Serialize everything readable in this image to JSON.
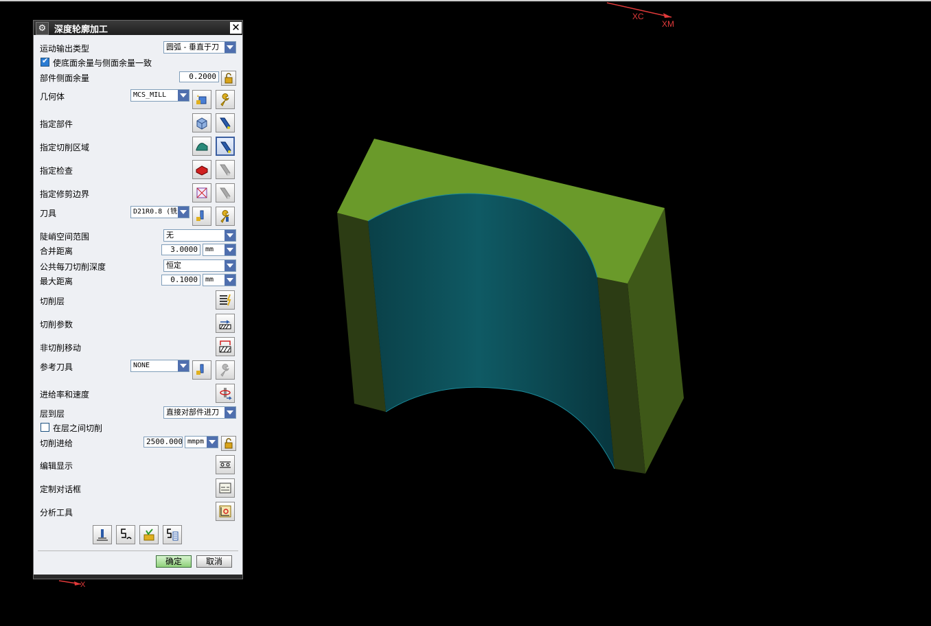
{
  "dialog": {
    "title": "深度轮廓加工",
    "fields": {
      "motion_output": {
        "label": "运动输出类型",
        "value": "圆弧 - 垂直于刀"
      },
      "floor_same_as_side": {
        "label": "使底面余量与侧面余量一致",
        "checked": true
      },
      "part_side_stock": {
        "label": "部件侧面余量",
        "value": "0.2000"
      },
      "geometry": {
        "label": "几何体",
        "value": "MCS_MILL"
      },
      "specify_part": {
        "label": "指定部件"
      },
      "specify_cut_area": {
        "label": "指定切削区域"
      },
      "specify_check": {
        "label": "指定检查"
      },
      "specify_trim": {
        "label": "指定修剪边界"
      },
      "tool": {
        "label": "刀具",
        "value": "D21R0.8 (铣"
      },
      "steep_range": {
        "label": "陡峭空间范围",
        "value": "无"
      },
      "merge_distance": {
        "label": "合并距离",
        "value": "3.0000",
        "unit": "mm"
      },
      "common_depth": {
        "label": "公共每刀切削深度",
        "value": "恒定"
      },
      "max_distance": {
        "label": "最大距离",
        "value": "0.1000",
        "unit": "mm"
      },
      "cut_levels": {
        "label": "切削层"
      },
      "cut_params": {
        "label": "切削参数"
      },
      "non_cut_moves": {
        "label": "非切削移动"
      },
      "ref_tool": {
        "label": "参考刀具",
        "value": "NONE"
      },
      "feeds_speeds": {
        "label": "进给率和速度"
      },
      "level_to_level": {
        "label": "层到层",
        "value": "直接对部件进刀"
      },
      "cut_between_levels": {
        "label": "在层之间切削",
        "checked": false
      },
      "cut_feed": {
        "label": "切削进给",
        "value": "2500.0000",
        "unit": "mmpm"
      },
      "edit_display": {
        "label": "编辑显示"
      },
      "custom_dialog": {
        "label": "定制对话框"
      },
      "analysis_tools": {
        "label": "分析工具"
      }
    },
    "buttons": {
      "ok": "确定",
      "cancel": "取消"
    }
  },
  "viewport": {
    "axes": {
      "xc": "XC",
      "xm": "XM",
      "x": "X"
    },
    "colors": {
      "top_face": "#6a9a2a",
      "side_face": "#2a3a14",
      "right_face": "#3f5a18",
      "inner_face": "#0e5560",
      "background": "#000000"
    }
  }
}
